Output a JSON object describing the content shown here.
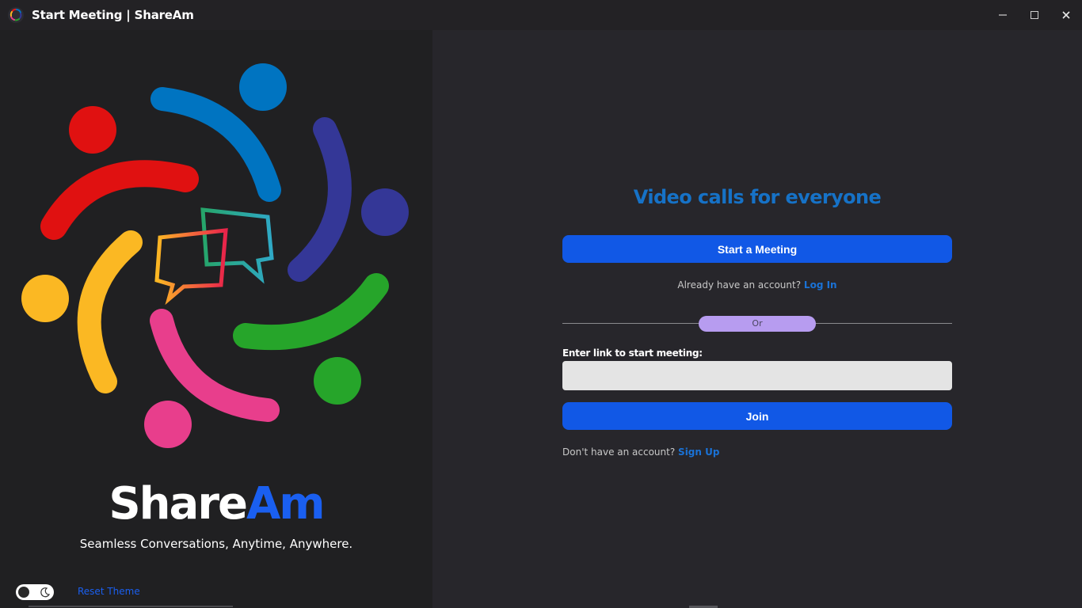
{
  "window": {
    "title": "Start Meeting | ShareAm"
  },
  "left_panel": {
    "brand_part1": "Share",
    "brand_part2": "Am",
    "tagline": "Seamless Conversations, Anytime, Anywhere.",
    "reset_theme_label": "Reset Theme",
    "theme_toggle_icon": "moon-icon"
  },
  "right_panel": {
    "headline": "Video calls for everyone",
    "start_meeting_label": "Start a Meeting",
    "login_prompt": "Already have an account?",
    "login_link": "Log In",
    "or_label": "Or",
    "link_field_label": "Enter link to start meeting:",
    "link_input_value": "",
    "join_label": "Join",
    "signup_prompt": "Don't have an account?",
    "signup_link": "Sign Up"
  },
  "colors": {
    "primary_button": "#1158e6",
    "headline": "#1672c7",
    "brand_accent": "#1a5ff0",
    "or_pill": "#b79cf0"
  }
}
